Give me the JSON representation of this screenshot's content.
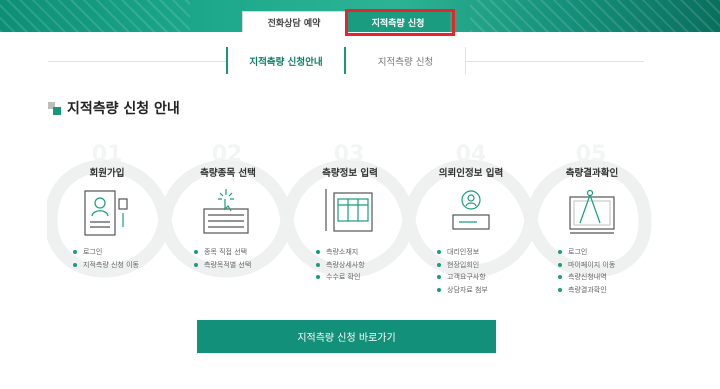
{
  "top_tabs": [
    {
      "label": "전화상담 예약"
    },
    {
      "label": "지적측량 신청"
    }
  ],
  "sub_tabs": [
    {
      "label": "지적측량 신청안내"
    },
    {
      "label": "지적측량 신청"
    }
  ],
  "section": {
    "title": "지적측량 신청 안내"
  },
  "steps": [
    {
      "title": "회원가입",
      "icon": "document-user-icon",
      "items": [
        "로그인",
        "지적측량 신청 이동"
      ]
    },
    {
      "title": "측량종목 선택",
      "icon": "keyboard-cursor-icon",
      "items": [
        "종목 직접 선택",
        "측량목적별 선택"
      ]
    },
    {
      "title": "측량정보 입력",
      "icon": "form-pencil-icon",
      "items": [
        "측량소재지",
        "측량상세사항",
        "수수료 확인"
      ]
    },
    {
      "title": "의뢰인정보 입력",
      "icon": "id-card-icon",
      "items": [
        "대리인정보",
        "현장입회인",
        "고객요구사항",
        "상담자료 첨부"
      ]
    },
    {
      "title": "측량결과확인",
      "icon": "blueprint-compass-icon",
      "items": [
        "로그인",
        "마이페이지 이동",
        "측량신청내역",
        "측량결과확인"
      ]
    }
  ],
  "cta": {
    "label": "지적측량 신청 바로가기"
  },
  "colors": {
    "accent": "#1a9c80",
    "highlight": "#e8232a",
    "wave": "#f0f2f1"
  }
}
